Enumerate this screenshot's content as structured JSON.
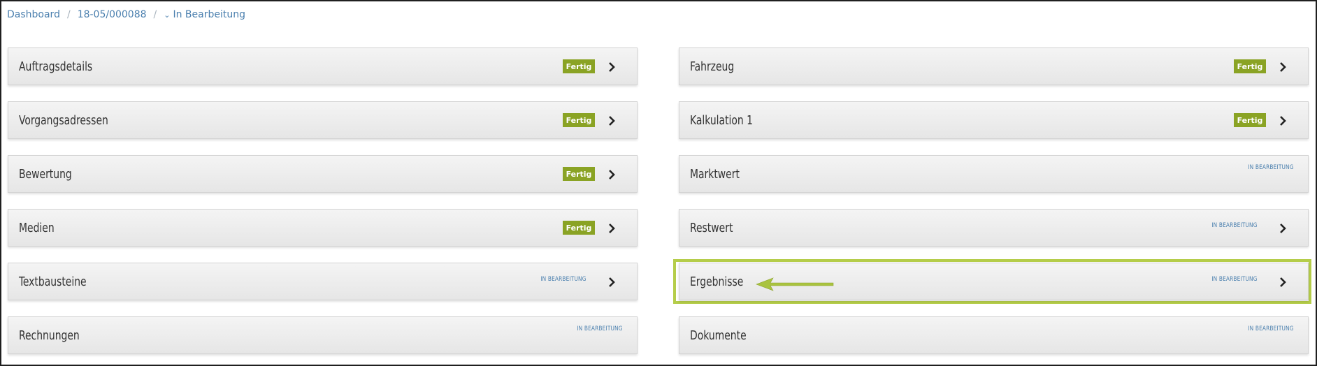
{
  "breadcrumb": {
    "dashboard": "Dashboard",
    "order": "18-05/000088",
    "status": "In Bearbeitung"
  },
  "left_column": [
    {
      "title": "Auftragsdetails",
      "status": "Fertig",
      "state": "done",
      "has_arrow": true
    },
    {
      "title": "Vorgangsadressen",
      "status": "Fertig",
      "state": "done",
      "has_arrow": true
    },
    {
      "title": "Bewertung",
      "status": "Fertig",
      "state": "done",
      "has_arrow": true
    },
    {
      "title": "Medien",
      "status": "Fertig",
      "state": "done",
      "has_arrow": true
    },
    {
      "title": "Textbausteine",
      "status": "IN BEARBEITUNG",
      "state": "progress",
      "has_arrow": true
    },
    {
      "title": "Rechnungen",
      "status": "IN BEARBEITUNG",
      "state": "progress",
      "has_arrow": false
    }
  ],
  "right_column": [
    {
      "title": "Fahrzeug",
      "status": "Fertig",
      "state": "done",
      "has_arrow": true
    },
    {
      "title": "Kalkulation 1",
      "status": "Fertig",
      "state": "done",
      "has_arrow": true
    },
    {
      "title": "Marktwert",
      "status": "IN BEARBEITUNG",
      "state": "progress",
      "has_arrow": false
    },
    {
      "title": "Restwert",
      "status": "IN BEARBEITUNG",
      "state": "progress",
      "has_arrow": true
    },
    {
      "title": "Ergebnisse",
      "status": "IN BEARBEITUNG",
      "state": "progress",
      "has_arrow": true,
      "highlighted": true
    },
    {
      "title": "Dokumente",
      "status": "IN BEARBEITUNG",
      "state": "progress",
      "has_arrow": false
    }
  ],
  "colors": {
    "done_badge": "#8aa324",
    "progress_text": "#4a7fae",
    "highlight_border": "#b5cd4a",
    "annotation_arrow": "#a9c33f"
  },
  "icons": {
    "row_arrow": "chevron-right-icon",
    "breadcrumb_toggle": "chevron-down-icon",
    "annotation": "arrow-left-icon"
  }
}
